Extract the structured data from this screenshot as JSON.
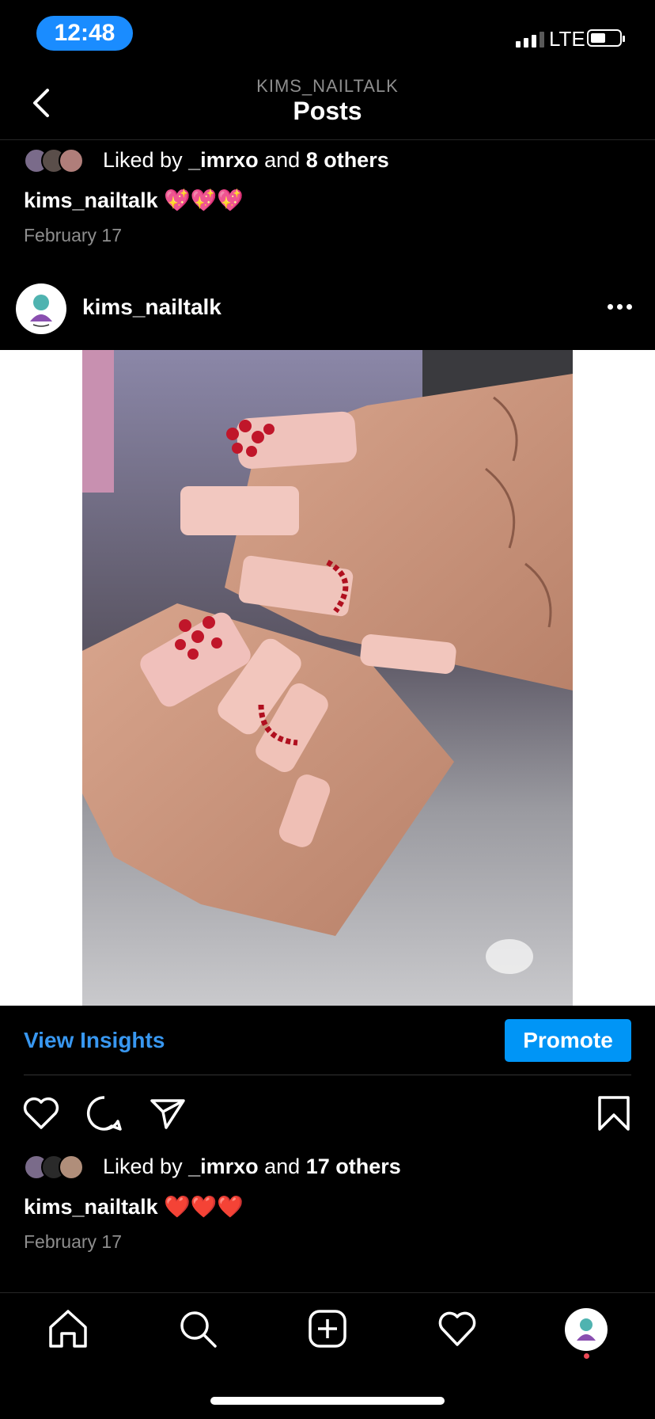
{
  "status_bar": {
    "time": "12:48",
    "network": "LTE",
    "battery_fill": 0.45
  },
  "header": {
    "account": "KIMS_NAILTALK",
    "title": "Posts"
  },
  "prev_post": {
    "liked_prefix": "Liked by ",
    "liked_user": "_imrxo",
    "liked_and": " and ",
    "liked_others": "8 others",
    "caption_user": "kims_nailtalk",
    "caption_text": "💖💖💖",
    "date": "February 17"
  },
  "post": {
    "username": "kims_nailtalk",
    "view_insights": "View Insights",
    "promote": "Promote",
    "liked_prefix": "Liked by ",
    "liked_user": "_imrxo",
    "liked_and": " and ",
    "liked_others": "17 others",
    "caption_user": "kims_nailtalk",
    "caption_text": "❤️❤️❤️",
    "date": "February 17"
  },
  "colors": {
    "accent": "#0095f6",
    "link": "#3897f0",
    "background": "#000000",
    "notification": "#ed4956"
  },
  "icons": {
    "back": "chevron-left-icon",
    "more": "more-horizontal-icon",
    "like": "heart-icon",
    "comment": "comment-icon",
    "share": "paper-plane-icon",
    "save": "bookmark-icon",
    "home": "home-icon",
    "search": "search-icon",
    "create": "plus-square-icon",
    "activity": "heart-icon"
  }
}
